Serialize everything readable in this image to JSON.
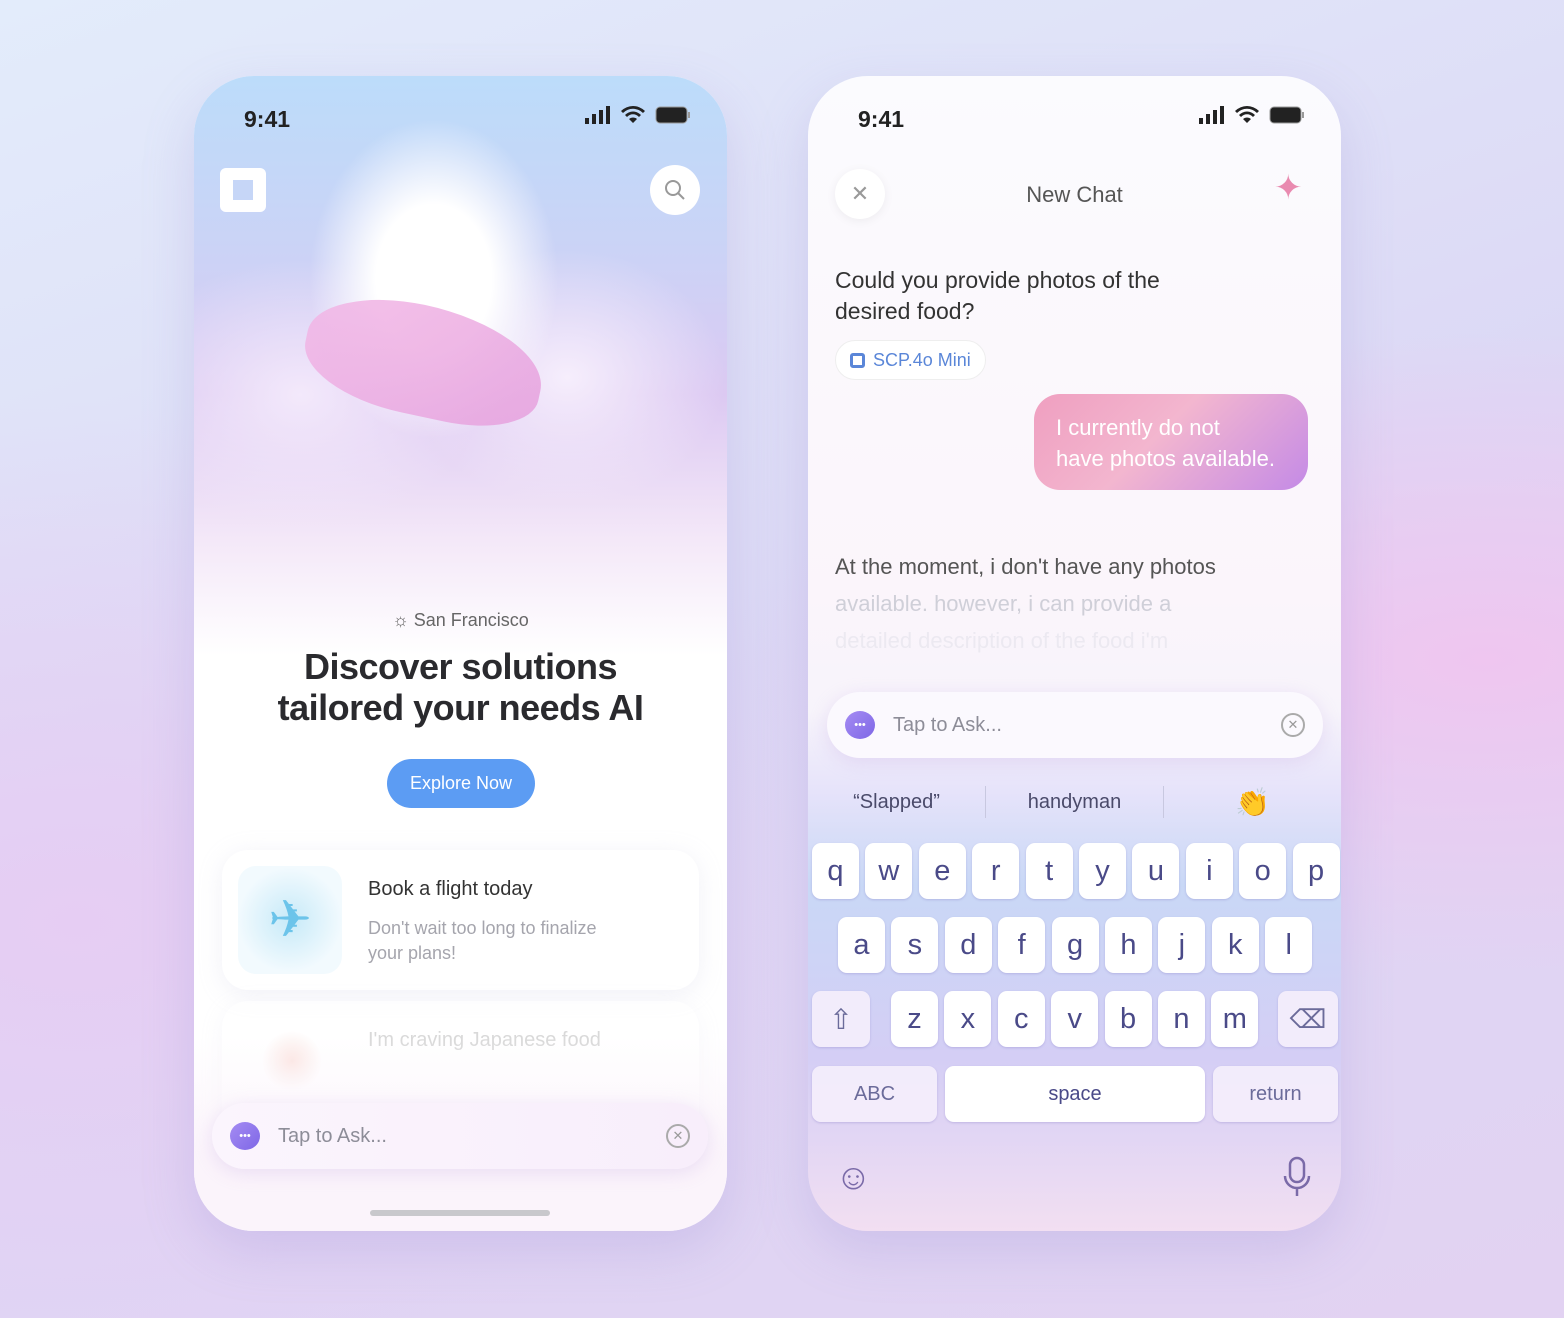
{
  "home": {
    "status_time": "9:41",
    "location": "San Francisco",
    "title_line1": "Discover solutions",
    "title_line2": "tailored your needs AI",
    "cta": "Explore Now",
    "cards": [
      {
        "title": "Book a flight today",
        "desc_line1": "Don't wait too long to finalize",
        "desc_line2": "your plans!",
        "icon": "airplane-icon"
      },
      {
        "title": "I'm craving Japanese food",
        "icon": "food-icon"
      }
    ],
    "ask_placeholder": "Tap to Ask..."
  },
  "chat": {
    "status_time": "9:41",
    "title": "New Chat",
    "question_line1": "Could you provide photos of the",
    "question_line2": "desired food?",
    "model": "SCP.4o Mini",
    "user_msg_line1": "I currently do not",
    "user_msg_line2": "have photos available.",
    "answer_line1": "At the moment, i don't have any photos",
    "answer_line2": "available. however, i can provide a",
    "answer_line3": "detailed description of the food i'm",
    "ask_placeholder": "Tap to Ask...",
    "suggestions": [
      "“Slapped”",
      "handyman",
      "👏"
    ],
    "keyboard": {
      "row1": [
        "q",
        "w",
        "e",
        "r",
        "t",
        "y",
        "u",
        "i",
        "o",
        "p"
      ],
      "row2": [
        "a",
        "s",
        "d",
        "f",
        "g",
        "h",
        "j",
        "k",
        "l"
      ],
      "row3": [
        "z",
        "x",
        "c",
        "v",
        "b",
        "n",
        "m"
      ],
      "abc": "ABC",
      "space": "space",
      "return": "return"
    }
  },
  "colors": {
    "accent": "#5c9cf3",
    "bubble_gradient": [
      "#f0a0c8",
      "#c98ae8"
    ]
  }
}
